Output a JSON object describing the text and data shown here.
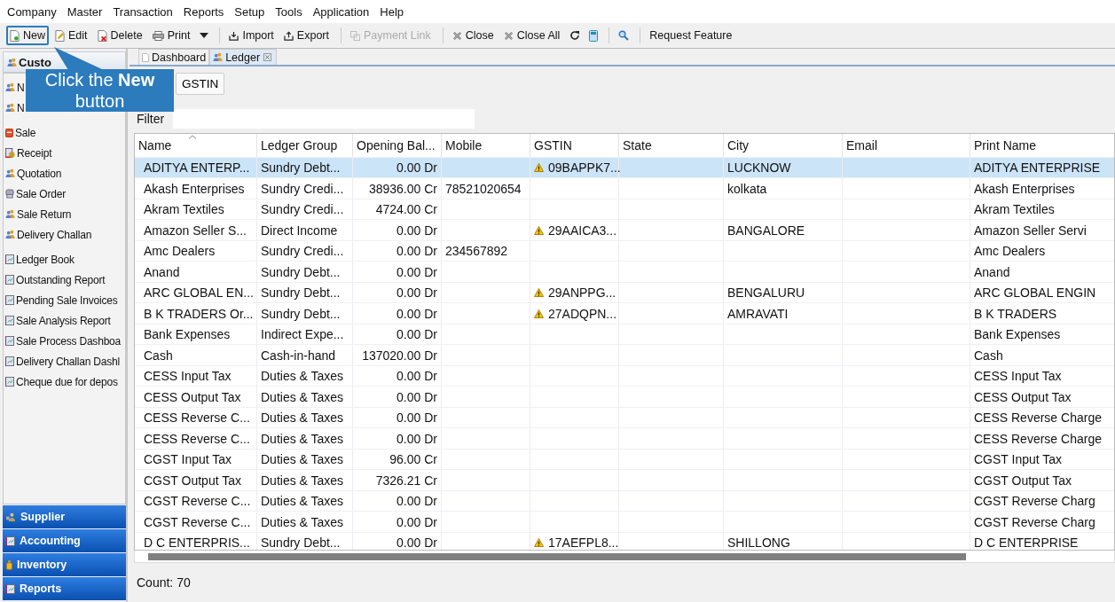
{
  "menu": [
    "Company",
    "Master",
    "Transaction",
    "Reports",
    "Setup",
    "Tools",
    "Application",
    "Help"
  ],
  "toolbar": [
    {
      "kind": "new",
      "label": "New",
      "disabled": false,
      "highlighted": true
    },
    {
      "kind": "edit",
      "label": "Edit",
      "disabled": false,
      "highlighted": false
    },
    {
      "kind": "delete",
      "label": "Delete",
      "disabled": false,
      "highlighted": false
    },
    {
      "kind": "print",
      "label": "Print",
      "disabled": false,
      "highlighted": false
    },
    {
      "kind": "caret",
      "disabled": false,
      "highlighted": false
    },
    {
      "kind": "separator"
    },
    {
      "kind": "import",
      "label": "Import",
      "disabled": false,
      "highlighted": false
    },
    {
      "kind": "export",
      "label": "Export",
      "disabled": false,
      "highlighted": false
    },
    {
      "kind": "separator"
    },
    {
      "kind": "link",
      "label": "Payment Link",
      "disabled": true,
      "highlighted": false
    },
    {
      "kind": "separator"
    },
    {
      "kind": "close",
      "label": "Close",
      "disabled": false,
      "highlighted": false
    },
    {
      "kind": "closeall",
      "label": "Close All",
      "disabled": false,
      "highlighted": false
    },
    {
      "kind": "refresh",
      "disabled": false,
      "highlighted": false
    },
    {
      "kind": "calculator",
      "disabled": false,
      "highlighted": false
    },
    {
      "kind": "separator"
    },
    {
      "kind": "search",
      "disabled": false,
      "highlighted": false
    },
    {
      "kind": "separator"
    },
    {
      "kind": "text",
      "label": "Request Feature",
      "disabled": false,
      "highlighted": false
    }
  ],
  "callout": {
    "text": "Click the **New** button"
  },
  "sidebar": {
    "header": "Custo",
    "groups": [
      [
        {
          "kind": "contact",
          "label": "N"
        },
        {
          "kind": "contact",
          "label": "N"
        }
      ],
      [
        {
          "kind": "sale",
          "label": "Sale"
        },
        {
          "kind": "receipt",
          "label": "Receipt"
        },
        {
          "kind": "contact",
          "label": "Quotation"
        },
        {
          "kind": "order",
          "label": "Sale Order"
        },
        {
          "kind": "contact",
          "label": "Sale Return"
        },
        {
          "kind": "contact",
          "label": "Delivery Challan"
        }
      ],
      [
        {
          "kind": "report",
          "label": "Ledger Book"
        },
        {
          "kind": "report",
          "label": "Outstanding Report"
        },
        {
          "kind": "report",
          "label": "Pending Sale Invoices"
        },
        {
          "kind": "report",
          "label": "Sale Analysis Report"
        },
        {
          "kind": "report",
          "label": "Sale Process Dashboa"
        },
        {
          "kind": "report",
          "label": "Delivery Challan Dashl"
        },
        {
          "kind": "report",
          "label": "Cheque due for depos"
        }
      ]
    ],
    "sections": [
      {
        "kind": "supplier",
        "label": "Supplier"
      },
      {
        "kind": "report",
        "label": "Accounting"
      },
      {
        "kind": "inventory",
        "label": "Inventory"
      },
      {
        "kind": "report",
        "label": "Reports"
      }
    ]
  },
  "tabs": [
    {
      "label": "Dashboard",
      "selected": false,
      "closable": false
    },
    {
      "label": "Ledger",
      "selected": true,
      "closable": true
    }
  ],
  "gstin_button": "GSTIN",
  "filter": {
    "label": "Filter"
  },
  "table": {
    "columns": [
      {
        "label": "Name",
        "sorted": true
      },
      {
        "label": "Ledger Group",
        "sorted": false
      },
      {
        "label": "Opening Bal...",
        "sorted": false
      },
      {
        "label": "Mobile",
        "sorted": false
      },
      {
        "label": "GSTIN",
        "sorted": false
      },
      {
        "label": "State",
        "sorted": false
      },
      {
        "label": "City",
        "sorted": false
      },
      {
        "label": "Email",
        "sorted": false
      },
      {
        "label": "Print Name",
        "sorted": false
      }
    ],
    "rows": [
      {
        "selected": true,
        "warning": true,
        "cells": [
          "ADITYA ENTERP...",
          "Sundry Debt...",
          "0.00 Dr",
          "",
          "09BAPPK7...",
          "",
          "LUCKNOW",
          "",
          "ADITYA ENTERPRISE"
        ]
      },
      {
        "selected": false,
        "warning": false,
        "cells": [
          "Akash Enterprises",
          "Sundry Credi...",
          "38936.00 Cr",
          "78521020654",
          "",
          "",
          "kolkata",
          "",
          "Akash Enterprises"
        ]
      },
      {
        "selected": false,
        "warning": false,
        "cells": [
          "Akram Textiles",
          "Sundry Credi...",
          "4724.00 Cr",
          "",
          "",
          "",
          "",
          "",
          "Akram Textiles"
        ]
      },
      {
        "selected": false,
        "warning": true,
        "cells": [
          "Amazon Seller S...",
          "Direct Income",
          "0.00 Dr",
          "",
          "29AAICA3...",
          "",
          "BANGALORE",
          "",
          "Amazon Seller Servi"
        ]
      },
      {
        "selected": false,
        "warning": false,
        "cells": [
          "Amc Dealers",
          "Sundry Credi...",
          "0.00 Dr",
          "234567892",
          "",
          "",
          "",
          "",
          "Amc Dealers"
        ]
      },
      {
        "selected": false,
        "warning": false,
        "cells": [
          "Anand",
          "Sundry Debt...",
          "0.00 Dr",
          "",
          "",
          "",
          "",
          "",
          "Anand"
        ]
      },
      {
        "selected": false,
        "warning": true,
        "cells": [
          "ARC GLOBAL EN...",
          "Sundry Debt...",
          "0.00 Dr",
          "",
          "29ANPPG...",
          "",
          "BENGALURU",
          "",
          "ARC GLOBAL ENGIN"
        ]
      },
      {
        "selected": false,
        "warning": true,
        "cells": [
          "B K TRADERS Or...",
          "Sundry Debt...",
          "0.00 Dr",
          "",
          "27ADQPN...",
          "",
          "AMRAVATI",
          "",
          "B K TRADERS"
        ]
      },
      {
        "selected": false,
        "warning": false,
        "cells": [
          "Bank Expenses",
          "Indirect Expe...",
          "0.00 Dr",
          "",
          "",
          "",
          "",
          "",
          "Bank Expenses"
        ]
      },
      {
        "selected": false,
        "warning": false,
        "cells": [
          "Cash",
          "Cash-in-hand",
          "137020.00 Dr",
          "",
          "",
          "",
          "",
          "",
          "Cash"
        ]
      },
      {
        "selected": false,
        "warning": false,
        "cells": [
          "CESS Input Tax",
          "Duties & Taxes",
          "0.00 Dr",
          "",
          "",
          "",
          "",
          "",
          "CESS Input Tax"
        ]
      },
      {
        "selected": false,
        "warning": false,
        "cells": [
          "CESS Output Tax",
          "Duties & Taxes",
          "0.00 Dr",
          "",
          "",
          "",
          "",
          "",
          "CESS Output Tax"
        ]
      },
      {
        "selected": false,
        "warning": false,
        "cells": [
          "CESS Reverse C...",
          "Duties & Taxes",
          "0.00 Dr",
          "",
          "",
          "",
          "",
          "",
          "CESS Reverse Charge"
        ]
      },
      {
        "selected": false,
        "warning": false,
        "cells": [
          "CESS Reverse C...",
          "Duties & Taxes",
          "0.00 Dr",
          "",
          "",
          "",
          "",
          "",
          "CESS Reverse Charge"
        ]
      },
      {
        "selected": false,
        "warning": false,
        "cells": [
          "CGST Input Tax",
          "Duties & Taxes",
          "96.00 Cr",
          "",
          "",
          "",
          "",
          "",
          "CGST Input Tax"
        ]
      },
      {
        "selected": false,
        "warning": false,
        "cells": [
          "CGST Output Tax",
          "Duties & Taxes",
          "7326.21 Cr",
          "",
          "",
          "",
          "",
          "",
          "CGST Output Tax"
        ]
      },
      {
        "selected": false,
        "warning": false,
        "cells": [
          "CGST Reverse C...",
          "Duties & Taxes",
          "0.00 Dr",
          "",
          "",
          "",
          "",
          "",
          "CGST Reverse Charg"
        ]
      },
      {
        "selected": false,
        "warning": false,
        "cells": [
          "CGST Reverse C...",
          "Duties & Taxes",
          "0.00 Dr",
          "",
          "",
          "",
          "",
          "",
          "CGST Reverse Charg"
        ]
      },
      {
        "selected": false,
        "warning": true,
        "cells": [
          "D C ENTERPRIS...",
          "Sundry Debt...",
          "0.00 Dr",
          "",
          "17AEFPL8...",
          "",
          "SHILLONG",
          "",
          "D C ENTERPRISE"
        ]
      }
    ]
  },
  "count": "Count: 70"
}
